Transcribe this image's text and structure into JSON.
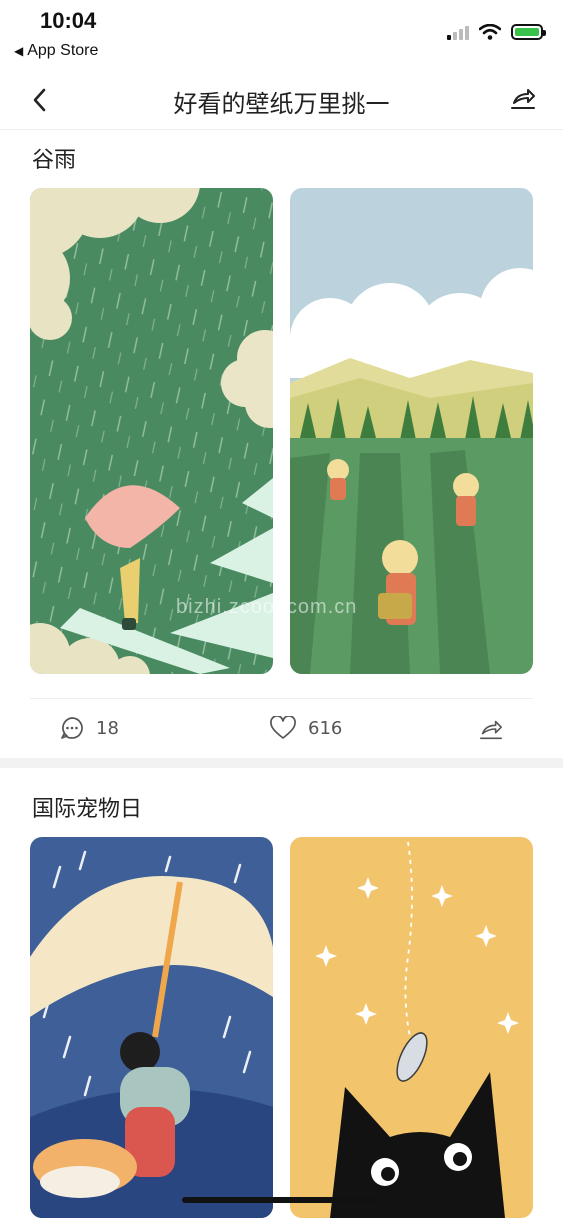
{
  "status_bar": {
    "time": "10:04",
    "back_app": "App Store",
    "back_glyph": "◀"
  },
  "nav": {
    "title": "好看的壁纸万里挑一",
    "back_icon": "chevron-left",
    "share_icon": "share"
  },
  "posts": [
    {
      "title": "谷雨",
      "images": [
        "girl-umbrella-crosswalk-rain",
        "tea-pickers-rain-field"
      ],
      "comments": "18",
      "likes": "616"
    },
    {
      "title": "国际宠物日",
      "images": [
        "child-dog-under-umbrella",
        "black-cat-fish"
      ]
    }
  ],
  "watermark": "bizhi.zcool.com.cn",
  "colors": {
    "accent_green": "#4a8a61",
    "rain_blue": "#3f5f98",
    "cat_yellow": "#f2c46c",
    "battery_green": "#39c24a"
  }
}
